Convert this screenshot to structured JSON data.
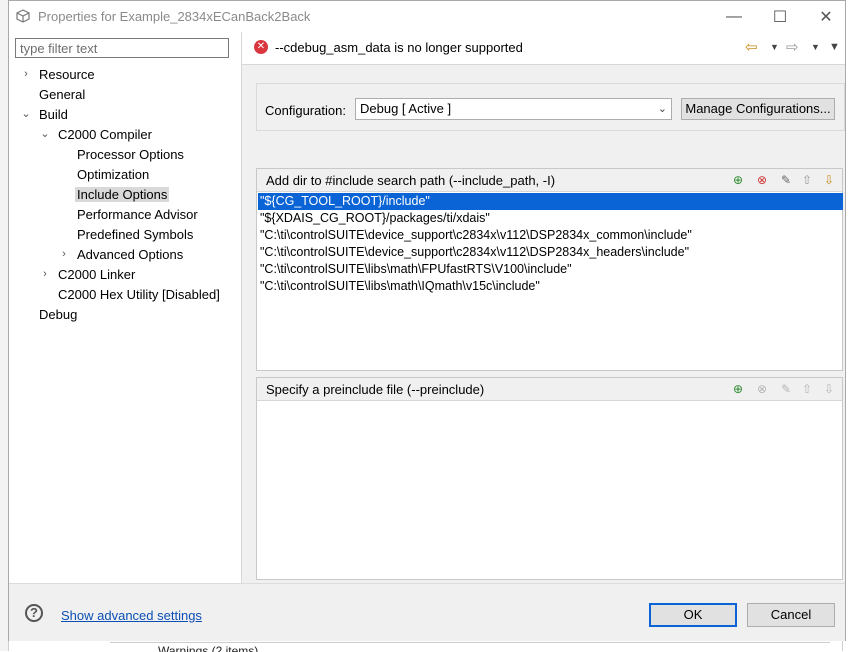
{
  "window": {
    "title": "Properties for Example_2834xECanBack2Back",
    "minimize_glyph": "—",
    "maximize_glyph": "☐",
    "close_glyph": "✕"
  },
  "filter": {
    "placeholder": "type filter text",
    "value": ""
  },
  "tree": [
    {
      "label": "Resource",
      "twisty": "›"
    },
    {
      "label": "General",
      "twisty": ""
    },
    {
      "label": "Build",
      "twisty": "⌄"
    },
    {
      "label": "C2000 Compiler",
      "twisty": "⌄"
    },
    {
      "label": "Processor Options",
      "twisty": ""
    },
    {
      "label": "Optimization",
      "twisty": ""
    },
    {
      "label": "Include Options",
      "twisty": ""
    },
    {
      "label": "Performance Advisor",
      "twisty": ""
    },
    {
      "label": "Predefined Symbols",
      "twisty": ""
    },
    {
      "label": "Advanced Options",
      "twisty": "›"
    },
    {
      "label": "C2000 Linker",
      "twisty": "›"
    },
    {
      "label": "C2000 Hex Utility  [Disabled]",
      "twisty": ""
    },
    {
      "label": "Debug",
      "twisty": ""
    }
  ],
  "message": {
    "text": "--cdebug_asm_data is no longer supported",
    "icon": "error-icon"
  },
  "configuration": {
    "label": "Configuration:",
    "selected": "Debug  [ Active ]",
    "manage_label": "Manage Configurations..."
  },
  "include_panel": {
    "title": "Add dir to #include search path (--include_path, -I)",
    "items": [
      "\"${CG_TOOL_ROOT}/include\"",
      "\"${XDAIS_CG_ROOT}/packages/ti/xdais\"",
      "\"C:\\ti\\controlSUITE\\device_support\\c2834x\\v112\\DSP2834x_common\\include\"",
      "\"C:\\ti\\controlSUITE\\device_support\\c2834x\\v112\\DSP2834x_headers\\include\"",
      "\"C:\\ti\\controlSUITE\\libs\\math\\FPUfastRTS\\V100\\include\"",
      "\"C:\\ti\\controlSUITE\\libs\\math\\IQmath\\v15c\\include\""
    ]
  },
  "preinclude_panel": {
    "title": "Specify a preinclude file (--preinclude)",
    "items": []
  },
  "bottom": {
    "advanced_link": "Show advanced settings",
    "ok_label": "OK",
    "cancel_label": "Cancel"
  },
  "background": {
    "bottom_text": "Warnings (2 items)"
  },
  "colors": {
    "selection": "#0a64d6",
    "error": "#d9363e",
    "link": "#0b4fb5"
  }
}
